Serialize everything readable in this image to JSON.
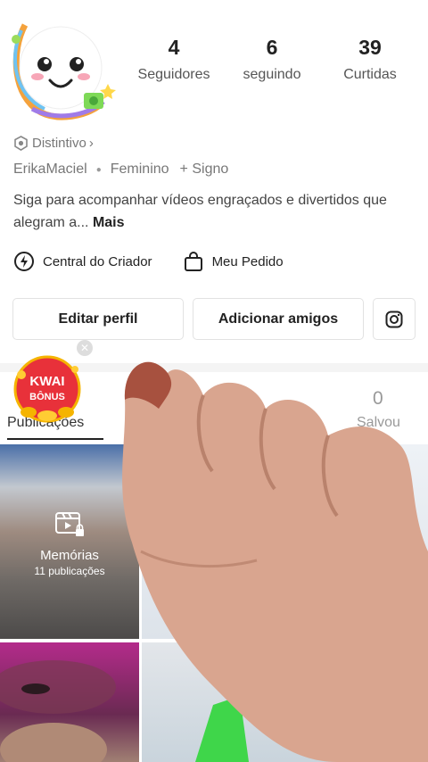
{
  "profile": {
    "username": "ErikaMaciel",
    "gender": "Feminino",
    "sign": "+ Signo",
    "badge": "Distintivo",
    "bio": "Siga para acompanhar vídeos engraçados e divertidos que alegram a...",
    "bio_more": "Mais"
  },
  "stats": [
    {
      "value": "4",
      "label": "Seguidores"
    },
    {
      "value": "6",
      "label": "seguindo"
    },
    {
      "value": "39",
      "label": "Curtidas"
    }
  ],
  "links": {
    "creator": "Central do Criador",
    "order": "Meu Pedido"
  },
  "buttons": {
    "edit": "Editar perfil",
    "add": "Adicionar amigos"
  },
  "kwai_bonus": {
    "line1": "KWAI",
    "line2": "BÔNUS"
  },
  "tabs": {
    "publications": "Publicações",
    "saved_count": "0",
    "saved": "Salvou"
  },
  "memories": {
    "title": "Memórias",
    "count": "11 publicações"
  },
  "colors": {
    "text": "#222222",
    "muted": "#777777",
    "bonus_red": "#e8313a",
    "bonus_gold": "#f5b400"
  }
}
